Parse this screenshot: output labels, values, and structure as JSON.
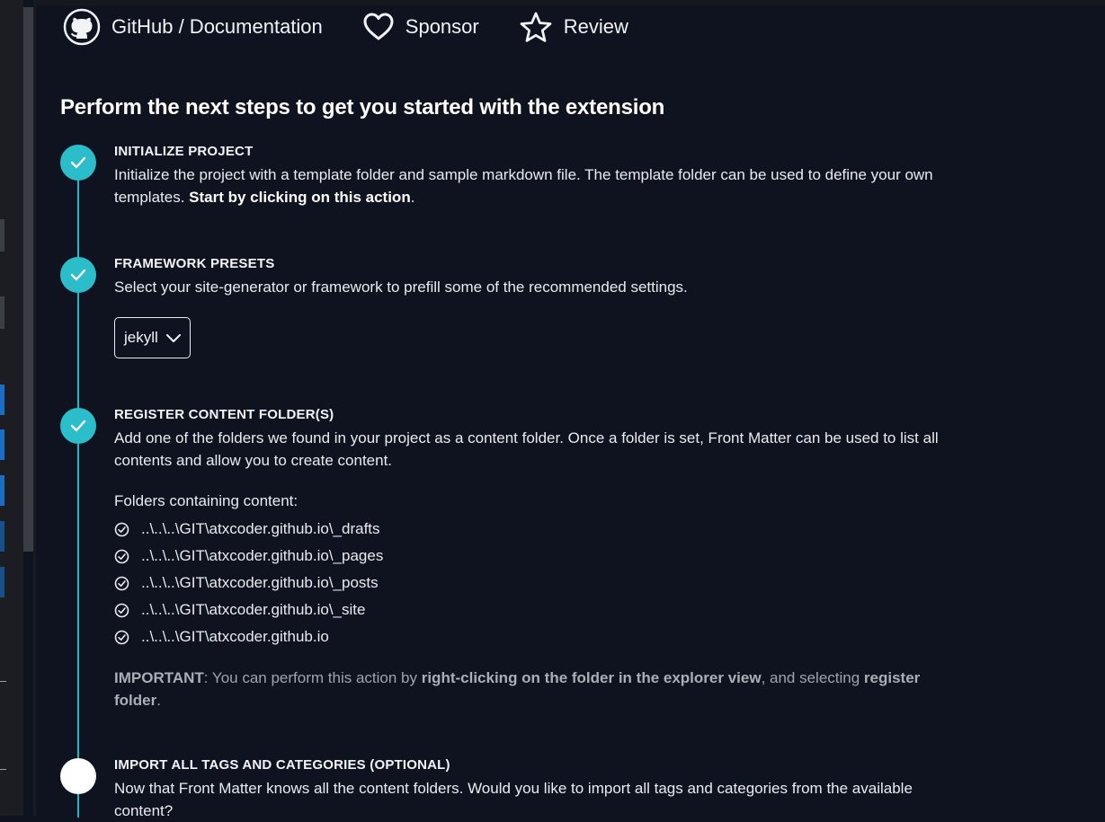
{
  "header": {
    "github_label": "GitHub / Documentation",
    "sponsor_label": "Sponsor",
    "review_label": "Review"
  },
  "title": "Perform the next steps to get you started with the extension",
  "steps": [
    {
      "title": "INITIALIZE PROJECT",
      "desc_text": "Initialize the project with a template folder and sample markdown file. The template folder can be used to define your own templates. ",
      "desc_bold": "Start by clicking on this action",
      "desc_end": ".",
      "status": "completed"
    },
    {
      "title": "FRAMEWORK PRESETS",
      "desc": "Select your site-generator or framework to prefill some of the recommended settings.",
      "select_value": "jekyll",
      "status": "completed"
    },
    {
      "title": "REGISTER CONTENT FOLDER(S)",
      "desc": "Add one of the folders we found in your project as a content folder. Once a folder is set, Front Matter can be used to list all contents and allow you to create content.",
      "folders_label": "Folders containing content:",
      "folders": [
        "..\\..\\..\\GIT\\atxcoder.github.io\\_drafts",
        "..\\..\\..\\GIT\\atxcoder.github.io\\_pages",
        "..\\..\\..\\GIT\\atxcoder.github.io\\_posts",
        "..\\..\\..\\GIT\\atxcoder.github.io\\_site",
        "..\\..\\..\\GIT\\atxcoder.github.io"
      ],
      "important_label": "IMPORTANT",
      "important_text1": ": You can perform this action by ",
      "important_bold1": "right-clicking on the folder in the explorer view",
      "important_text2": ", and selecting ",
      "important_bold2": "register folder",
      "important_end": ".",
      "status": "completed"
    },
    {
      "title": "IMPORT ALL TAGS AND CATEGORIES (OPTIONAL)",
      "desc": "Now that Front Matter knows all the content folders. Would you like to import all tags and categories from the available content?",
      "status": "pending"
    }
  ],
  "colors": {
    "background": "#0f1320",
    "accent": "#2bbdca",
    "pending": "#ffffff"
  }
}
